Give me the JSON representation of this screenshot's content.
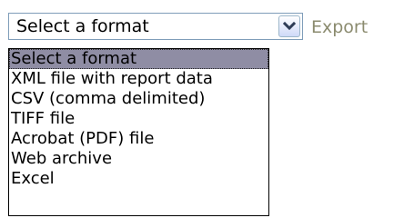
{
  "format_select": {
    "value": "Select a format",
    "options": [
      "Select a format",
      "XML file with report data",
      "CSV (comma delimited)",
      "TIFF file",
      "Acrobat (PDF) file",
      "Web archive",
      "Excel"
    ],
    "highlighted_option": "Select a format",
    "dropdown_icon": "chevron-down-icon"
  },
  "export_button": {
    "label": "Export"
  },
  "colors": {
    "highlight": "#8f8da4",
    "export_text_disabled": "#8b8b6f",
    "select_border": "#7f9db9"
  }
}
